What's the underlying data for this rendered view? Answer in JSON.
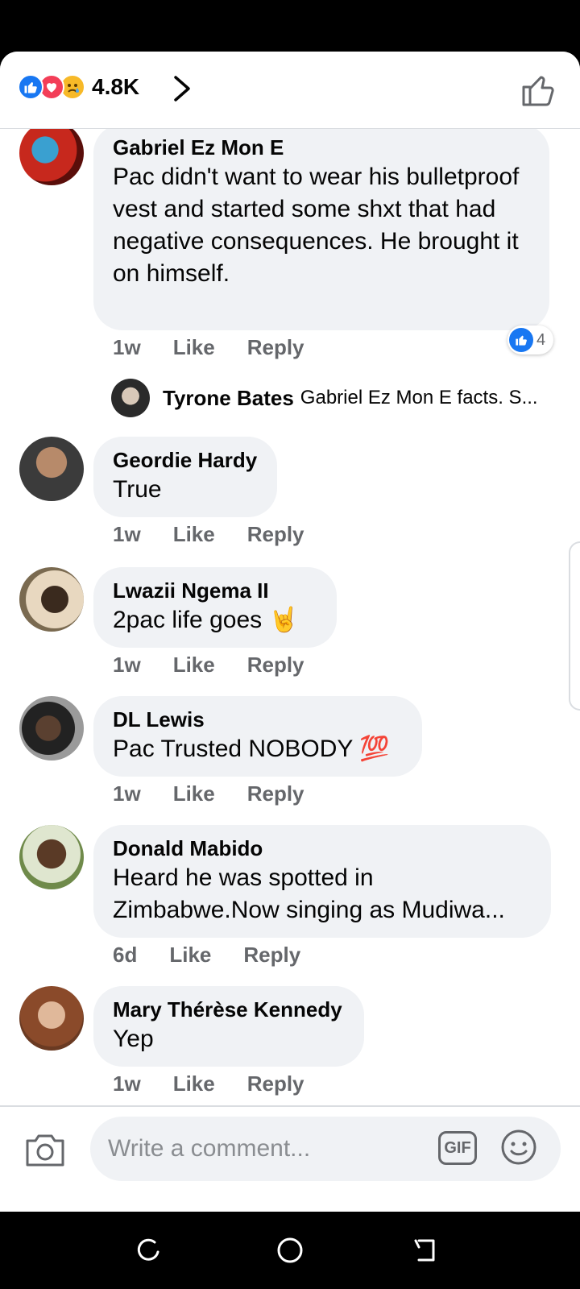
{
  "header": {
    "reaction_icons": [
      "like-reaction-icon",
      "love-reaction-icon",
      "sad-reaction-icon"
    ],
    "reaction_count": "4.8K"
  },
  "comments": [
    {
      "author": "Gabriel Ez Mon E",
      "text": "Pac didn't want to wear his bulletproof vest and started some shxt that had negative consequences. He brought it on himself.",
      "time": "1w",
      "like_label": "Like",
      "reply_label": "Reply",
      "reaction_count": "4",
      "reply_preview": {
        "author": "Tyrone Bates",
        "text": "Gabriel Ez Mon E facts.  S..."
      }
    },
    {
      "author": "Geordie Hardy",
      "text": "True",
      "time": "1w",
      "like_label": "Like",
      "reply_label": "Reply"
    },
    {
      "author": "Lwazii Ngema II",
      "text": "2pac life goes 🤘",
      "time": "1w",
      "like_label": "Like",
      "reply_label": "Reply"
    },
    {
      "author": "DL Lewis",
      "text": "Pac Trusted NOBODY 💯",
      "time": "1w",
      "like_label": "Like",
      "reply_label": "Reply"
    },
    {
      "author": "Donald Mabido",
      "text": "Heard he was spotted in Zimbabwe.Now singing as Mudiwa...",
      "time": "6d",
      "like_label": "Like",
      "reply_label": "Reply"
    },
    {
      "author": "Mary Thérèse Kennedy",
      "text": "Yep",
      "time": "1w",
      "like_label": "Like",
      "reply_label": "Reply"
    }
  ],
  "composer": {
    "placeholder": "Write a comment...",
    "gif_label": "GIF"
  },
  "colors": {
    "facebook_blue": "#1877f2",
    "bubble_gray": "#f0f2f5",
    "meta_gray": "#65676b"
  }
}
